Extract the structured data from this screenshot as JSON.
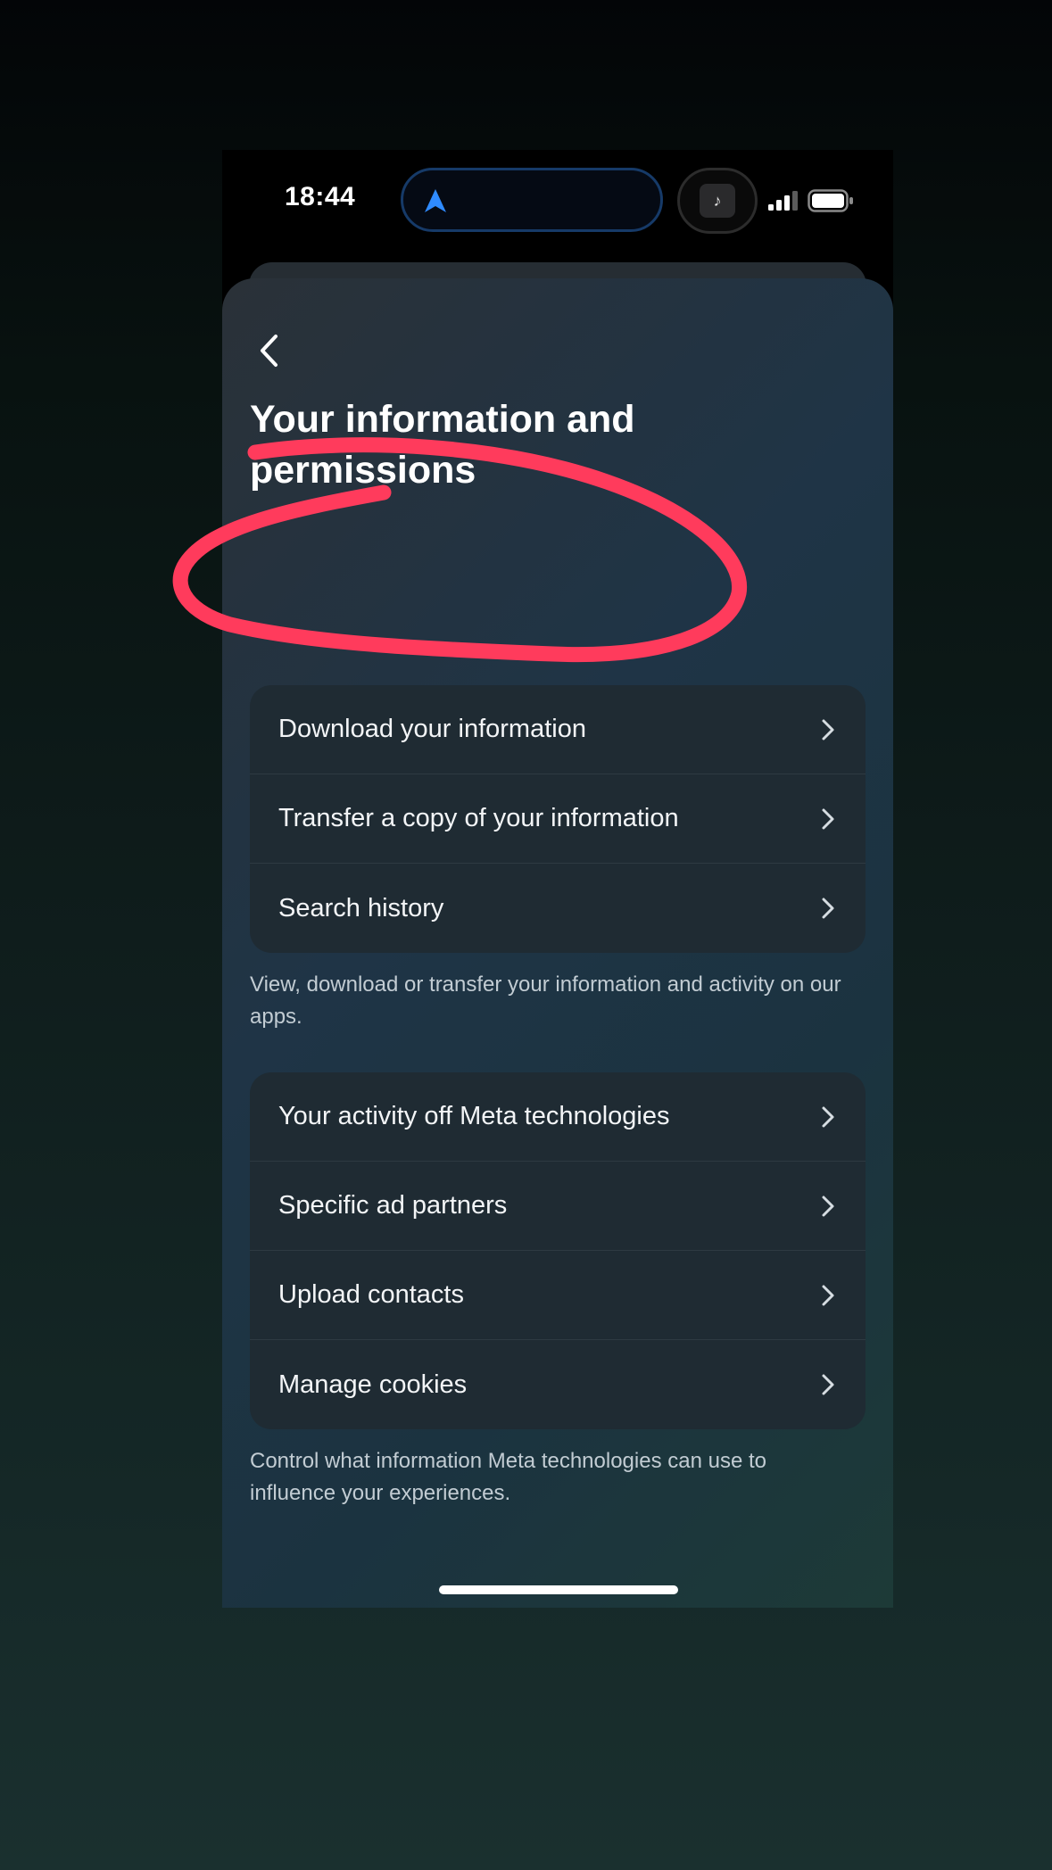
{
  "status_bar": {
    "time": "18:44",
    "music_glyph": "♪"
  },
  "icons": {
    "navigation": "location-arrow-icon",
    "music": "music-note-icon",
    "signal": "cellular-signal-icon",
    "battery": "battery-icon",
    "back": "chevron-left-icon",
    "row": "chevron-right-icon"
  },
  "page": {
    "title": "Your information and permissions"
  },
  "group1": {
    "items": [
      {
        "label": "Download your information"
      },
      {
        "label": "Transfer a copy of your information"
      },
      {
        "label": "Search history"
      }
    ],
    "caption": "View, download or transfer your information and activity on our apps."
  },
  "group2": {
    "items": [
      {
        "label": "Your activity off Meta technologies"
      },
      {
        "label": "Specific ad partners"
      },
      {
        "label": "Upload contacts"
      },
      {
        "label": "Manage cookies"
      }
    ],
    "caption": "Control what information Meta technologies can use to influence your experiences."
  },
  "colors": {
    "annotation": "#ff3b5c",
    "nav_arrow": "#2f8bff",
    "island_border": "#163a68"
  }
}
